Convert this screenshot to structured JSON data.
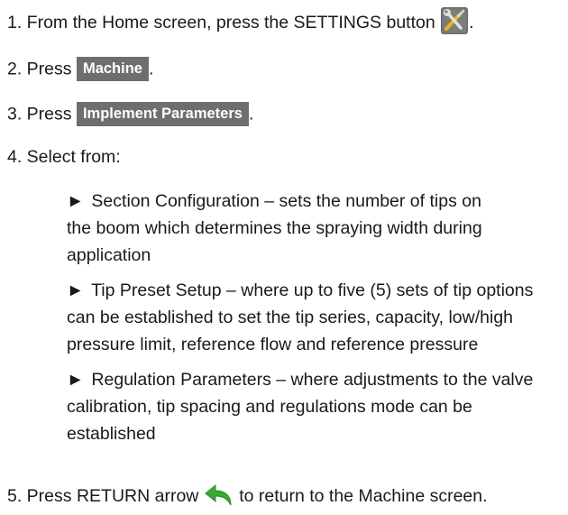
{
  "steps": {
    "s1": {
      "before": "1. From the Home screen, press the SETTINGS button",
      "after": ".",
      "icon": "settings-icon"
    },
    "s2": {
      "before": "2. Press",
      "button": "Machine",
      "after": "."
    },
    "s3": {
      "before": "3. Press",
      "button": "Implement Parameters",
      "after": "."
    },
    "s4": {
      "text": "4. Select from:"
    },
    "s5": {
      "before": "5. Press RETURN arrow",
      "after": "to return to the Machine screen.",
      "icon": "return-arrow-icon"
    }
  },
  "bullets": [
    {
      "marker": "►",
      "lines": [
        "Section Configuration – sets the number of tips on",
        "the boom which determines the spraying width during",
        "application"
      ]
    },
    {
      "marker": "►",
      "lines": [
        "Tip Preset Setup – where up to five (5) sets of tip options",
        "can be established to set the tip series, capacity, low/high",
        "pressure limit, reference flow and reference pressure"
      ]
    },
    {
      "marker": "►",
      "lines": [
        "Regulation Parameters – where adjustments to the valve",
        "calibration, tip spacing and regulations mode can be",
        "established"
      ]
    }
  ],
  "colors": {
    "button_bg": "#6e6e6e",
    "return_arrow": "#3aa832",
    "settings_bg": "#6a6a6a"
  }
}
